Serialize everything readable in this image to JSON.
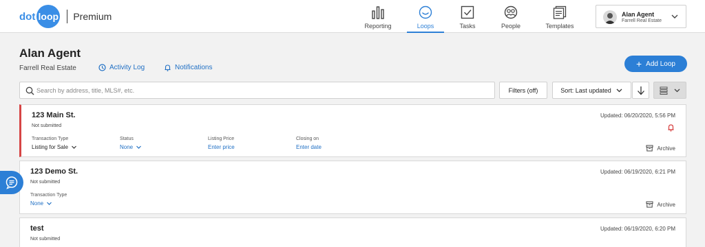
{
  "brand": {
    "logo_dot": "dot",
    "logo_loop": "loop",
    "product": "Premium",
    "accent": "#2c7fd6"
  },
  "nav": {
    "items": [
      {
        "label": "Reporting",
        "icon": "bar-chart-icon"
      },
      {
        "label": "Loops",
        "icon": "loop-icon",
        "active": true
      },
      {
        "label": "Tasks",
        "icon": "checkbox-icon"
      },
      {
        "label": "People",
        "icon": "people-icon"
      },
      {
        "label": "Templates",
        "icon": "templates-icon"
      }
    ]
  },
  "user": {
    "name": "Alan Agent",
    "org": "Farrell Real Estate"
  },
  "page": {
    "title": "Alan Agent",
    "org": "Farrell Real Estate",
    "activity_log": "Activity Log",
    "notifications": "Notifications",
    "add_loop": "Add Loop"
  },
  "toolbar": {
    "search_placeholder": "Search by address, title, MLS#, etc.",
    "filters": "Filters (off)",
    "sort": "Sort: Last updated"
  },
  "loops": [
    {
      "title": "123 Main St.",
      "status_text": "Not submitted",
      "updated": "Updated: 06/20/2020, 5:56 PM",
      "has_alert": true,
      "fields": [
        {
          "label": "Transaction Type",
          "value": "Listing for Sale"
        },
        {
          "label": "Status",
          "value": "None"
        },
        {
          "label": "Listing Price",
          "value": "Enter price"
        },
        {
          "label": "Closing on",
          "value": "Enter date"
        }
      ],
      "archive": "Archive"
    },
    {
      "title": "123 Demo St.",
      "status_text": "Not submitted",
      "updated": "Updated: 06/19/2020, 6:21 PM",
      "fields": [
        {
          "label": "Transaction Type",
          "value": "None"
        }
      ],
      "archive": "Archive"
    },
    {
      "title": "test",
      "status_text": "Not submitted",
      "updated": "Updated: 06/19/2020, 6:20 PM"
    }
  ]
}
